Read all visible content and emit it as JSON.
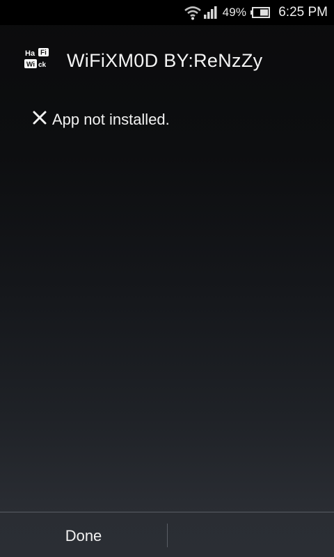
{
  "status_bar": {
    "wifi_icon": "wifi-icon",
    "signal_icon": "cell-signal-icon",
    "battery_percent": "49%",
    "battery_icon": "battery-icon",
    "time": "6:25 PM"
  },
  "header": {
    "app_icon": {
      "name": "hafi-wick-app-icon",
      "lines": [
        "Ha",
        "Fi",
        "Wi",
        "ck"
      ]
    },
    "title": "WiFiXM0D BY:ReNzZy"
  },
  "main": {
    "status_icon": "close-x-icon",
    "message": "App not installed."
  },
  "footer": {
    "done_label": "Done"
  },
  "colors": {
    "background_top": "#0b0b0c",
    "background_bottom": "#2b2e34",
    "text": "#f2f2f2",
    "divider": "#5a5e66"
  }
}
